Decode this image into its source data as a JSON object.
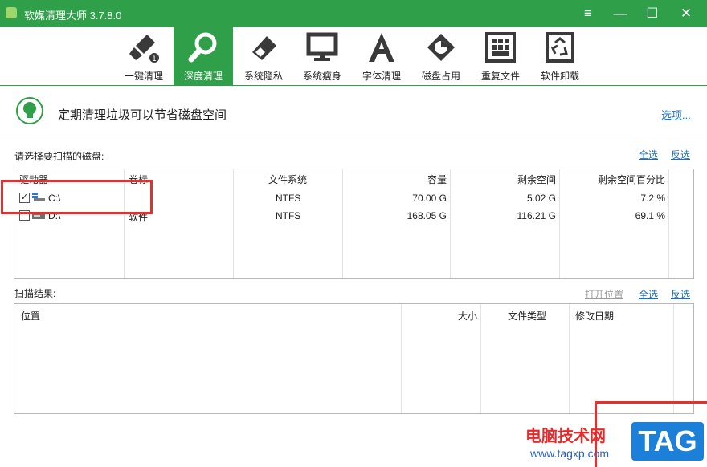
{
  "window": {
    "title": "软媒清理大师 3.7.8.0",
    "menu_glyph": "≡",
    "min_glyph": "—",
    "max_glyph": "☐",
    "close_glyph": "✕"
  },
  "toolbar": {
    "items": [
      {
        "label": "一键清理",
        "icon": "broom-icon"
      },
      {
        "label": "深度清理",
        "icon": "magnifier-icon"
      },
      {
        "label": "系统隐私",
        "icon": "eraser-icon"
      },
      {
        "label": "系统瘦身",
        "icon": "monitor-icon"
      },
      {
        "label": "字体清理",
        "icon": "letter-a-icon"
      },
      {
        "label": "磁盘占用",
        "icon": "disk-pie-icon"
      },
      {
        "label": "重复文件",
        "icon": "grid-file-icon"
      },
      {
        "label": "软件卸载",
        "icon": "recycle-bin-icon"
      }
    ],
    "active_index": 1,
    "badge_number": "1"
  },
  "banner": {
    "text": "定期清理垃圾可以节省磁盘空间",
    "options_link": "选项..."
  },
  "disk_section": {
    "label": "请选择要扫描的磁盘:",
    "select_all": "全选",
    "invert": "反选",
    "columns": [
      "驱动器",
      "卷标",
      "文件系统",
      "容量",
      "剩余空间",
      "剩余空间百分比"
    ],
    "rows": [
      {
        "checked": true,
        "check_glyph": "✓",
        "drive": "C:\\",
        "volume": "",
        "fs": "NTFS",
        "capacity": "70.00 G",
        "free": "5.02 G",
        "percent": "7.2 %"
      },
      {
        "checked": false,
        "check_glyph": "",
        "drive": "D:\\",
        "volume": "软件",
        "fs": "NTFS",
        "capacity": "168.05 G",
        "free": "116.21 G",
        "percent": "69.1 %"
      }
    ]
  },
  "result_section": {
    "label": "扫描结果:",
    "open_location": "打开位置",
    "select_all": "全选",
    "invert": "反选",
    "columns": [
      "位置",
      "大小",
      "文件类型",
      "修改日期"
    ]
  },
  "watermark": {
    "site_name": "电脑技术网",
    "url": "www.tagxp.com",
    "badge": "TAG"
  },
  "colors": {
    "brand_green": "#2f9f49",
    "link_blue": "#1b6ec2",
    "highlight_red": "#e53030"
  }
}
